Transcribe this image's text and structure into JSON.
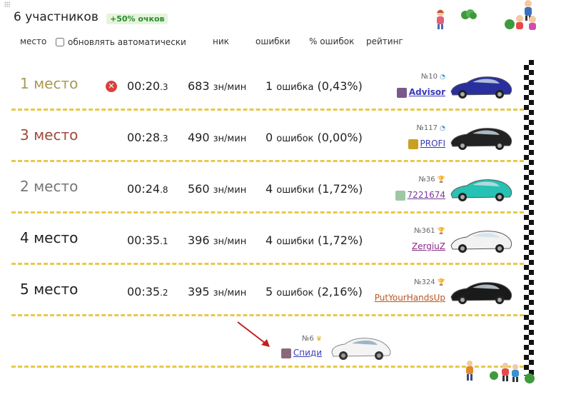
{
  "header": {
    "participants": "6 участников",
    "bonus": "+50% очков"
  },
  "columns": {
    "place": "место",
    "auto_update": "обновлять автоматически",
    "nick": "ник",
    "errors": "ошибки",
    "error_pct": "% ошибок",
    "rating": "рейтинг"
  },
  "rows": [
    {
      "place": "1 место",
      "place_color": "#a89a55",
      "failed": true,
      "fail_glyph": "✕",
      "time_main": "00:20",
      "time_frac": ".3",
      "speed_num": "683",
      "speed_unit": "зн/мин",
      "errors_num": "1",
      "errors_text": "ошибка",
      "errors_pct": "(0,43%)",
      "rank": "№10",
      "nick": "Advisor",
      "nick_color": "#3a3ab8",
      "nick_bold": true,
      "avatar_color": "#7a5a8a",
      "car_color": "#2a2f9e"
    },
    {
      "place": "3 место",
      "place_color": "#a04a3a",
      "failed": false,
      "time_main": "00:28",
      "time_frac": ".3",
      "speed_num": "490",
      "speed_unit": "зн/мин",
      "errors_num": "0",
      "errors_text": "ошибок",
      "errors_pct": "(0,00%)",
      "rank": "№117",
      "nick": "PROFI",
      "nick_color": "#3a3ab8",
      "nick_bold": false,
      "avatar_color": "#c9a020",
      "car_color": "#222222"
    },
    {
      "place": "2 место",
      "place_color": "#777777",
      "failed": false,
      "time_main": "00:24",
      "time_frac": ".8",
      "speed_num": "560",
      "speed_unit": "зн/мин",
      "errors_num": "4",
      "errors_text": "ошибки",
      "errors_pct": "(1,72%)",
      "rank": "№36",
      "nick": "7221674",
      "nick_color": "#7a3a9a",
      "nick_bold": false,
      "avatar_color": "#9ec8a4",
      "car_color": "#27c2b4"
    },
    {
      "place": "4 место",
      "place_color": "#222222",
      "failed": false,
      "time_main": "00:35",
      "time_frac": ".1",
      "speed_num": "396",
      "speed_unit": "зн/мин",
      "errors_num": "4",
      "errors_text": "ошибки",
      "errors_pct": "(1,72%)",
      "rank": "№361",
      "nick": "ZergiuZ",
      "nick_color": "#8a2a8a",
      "nick_bold": false,
      "avatar_color": "",
      "car_color": "#f2f2f2"
    },
    {
      "place": "5 место",
      "place_color": "#222222",
      "failed": false,
      "time_main": "00:35",
      "time_frac": ".2",
      "speed_num": "395",
      "speed_unit": "зн/мин",
      "errors_num": "5",
      "errors_text": "ошибок",
      "errors_pct": "(2,16%)",
      "rank": "№324",
      "nick": "PutYourHandsUp",
      "nick_color": "#b8561e",
      "nick_bold": false,
      "avatar_color": "",
      "car_color": "#1a1a1a"
    }
  ],
  "current": {
    "rank": "№6",
    "nick": "Спиди",
    "nick_color": "#3a3ab8",
    "avatar_color": "#8a6a7a",
    "car_color": "#f4f4f4"
  },
  "colors": {
    "lane_line": "#e8c94a",
    "bonus_green": "#2e8b2e",
    "arrow": "#c02020"
  }
}
